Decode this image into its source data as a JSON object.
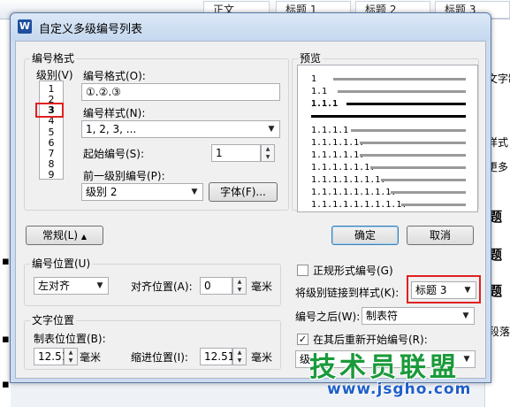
{
  "background": {
    "styles": [
      "正文",
      "标题 1",
      "标题 2",
      "标题 3"
    ],
    "right_fragments": [
      "文字制",
      "样式",
      "更多",
      "题",
      "题",
      "题",
      "段落"
    ]
  },
  "dialog": {
    "title": "自定义多级编号列表",
    "app_icon_letter": "W",
    "number_format_group": "编号格式",
    "level_label": "级别(V)",
    "levels": [
      "1",
      "2",
      "3",
      "4",
      "5",
      "6",
      "7",
      "8",
      "9"
    ],
    "selected_level": "3",
    "number_format_label": "编号格式(O):",
    "number_format_value": "①.②.③",
    "number_style_label": "编号样式(N):",
    "number_style_value": "1, 2, 3, ...",
    "start_at_label": "起始编号(S):",
    "start_at_value": "1",
    "prev_level_label": "前一级别编号(P):",
    "prev_level_value": "级别 2",
    "font_button": "字体(F)...",
    "preview_label": "预览",
    "preview_rows": [
      "1",
      "1.1",
      "1.1.1",
      "1.1.1.1",
      "1.1.1.1.1.",
      "1.1.1.1.1.",
      "1.1.1.1.1.1.",
      "1.1.1.1.1.1.1.",
      "1.1.1.1.1.1.1.1.",
      "1.1.1.1.1.1.1.1.1."
    ],
    "general_button": "常规(L)",
    "ok_button": "确定",
    "cancel_button": "取消",
    "number_position_group": "编号位置(U)",
    "alignment_value": "左对齐",
    "align_at_label": "对齐位置(A):",
    "align_at_value": "0",
    "unit_cm": "毫米",
    "text_position_group": "文字位置",
    "tab_stop_label": "制表位位置(B):",
    "tab_stop_value": "12.51",
    "indent_label": "缩进位置(I):",
    "indent_value": "12.51",
    "legal_style_label": "正规形式编号(G)",
    "legal_style_checked": false,
    "link_style_label": "将级别链接到样式(K):",
    "link_style_value": "标题 3",
    "follow_number_label": "编号之后(W):",
    "follow_number_value": "制表符",
    "restart_label": "在其后重新开始编号(R):",
    "restart_checked": true,
    "restart_value": "级"
  },
  "watermark": {
    "text": "技术员联盟",
    "url": "www.jsgho.com"
  },
  "colors": {
    "highlight": "#e02020",
    "dialog_bg": "#f0f0f0",
    "title_bg": "#cddcef"
  }
}
